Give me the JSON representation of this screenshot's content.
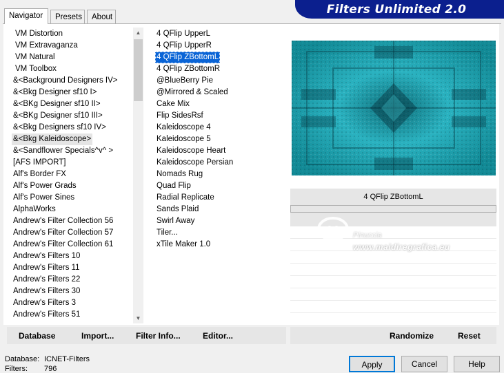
{
  "banner": {
    "title": "Filters Unlimited 2.0",
    "color": "#0b1f8e"
  },
  "tabs": [
    {
      "label": "Navigator",
      "active": true
    },
    {
      "label": "Presets",
      "active": false
    },
    {
      "label": "About",
      "active": false
    }
  ],
  "categories": [
    "VM Distortion",
    "VM Extravaganza",
    "VM Natural",
    "VM Toolbox",
    "&<Background Designers IV>",
    "&<Bkg Designer sf10 I>",
    "&<BKg Designer sf10 II>",
    "&<BKg Designer sf10 III>",
    "&<Bkg Designers sf10 IV>",
    "&<Bkg Kaleidoscope>",
    "&<Sandflower Specials^v^ >",
    "[AFS IMPORT]",
    "Alf's Border FX",
    "Alf's Power Grads",
    "Alf's Power Sines",
    "AlphaWorks",
    "Andrew's Filter Collection 56",
    "Andrew's Filter Collection 57",
    "Andrew's Filter Collection 61",
    "Andrew's Filters 10",
    "Andrew's Filters 11",
    "Andrew's Filters 22",
    "Andrew's Filters 30",
    "Andrew's Filters 3",
    "Andrew's Filters 51"
  ],
  "selected_category": "&<Bkg Kaleidoscope>",
  "filters": [
    "4 QFlip UpperL",
    "4 QFlip UpperR",
    "4 QFlip ZBottomL",
    "4 QFlip ZBottomR",
    "@BlueBerry Pie",
    "@Mirrored & Scaled",
    "Cake Mix",
    "Flip SidesRsf",
    "Kaleidoscope 4",
    "Kaleidoscope 5",
    "Kaleidoscope Heart",
    "Kaleidoscope Persian",
    "Nomads Rug",
    "Quad Flip",
    "Radial Replicate",
    "Sands Plaid",
    "Swirl Away",
    "Tiler...",
    "xTile Maker 1.0"
  ],
  "selected_filter": "4 QFlip ZBottomL",
  "preview": {
    "filter_name": "4 QFlip ZBottomL",
    "accent": "#1fa2ae"
  },
  "watermark": {
    "line1": "Pinuccia",
    "line2": "www.maidiregrafica.eu"
  },
  "left_buttons": {
    "database": "Database",
    "import": "Import...",
    "filter_info": "Filter Info...",
    "editor": "Editor..."
  },
  "right_buttons": {
    "randomize": "Randomize",
    "reset": "Reset"
  },
  "status": {
    "database_label": "Database:",
    "database_value": "ICNET-Filters",
    "filters_label": "Filters:",
    "filters_value": "796"
  },
  "dialog_buttons": {
    "apply": "Apply",
    "cancel": "Cancel",
    "help": "Help"
  },
  "icons": {
    "scroll_up": "chevron-up-icon",
    "scroll_down": "chevron-down-icon"
  }
}
